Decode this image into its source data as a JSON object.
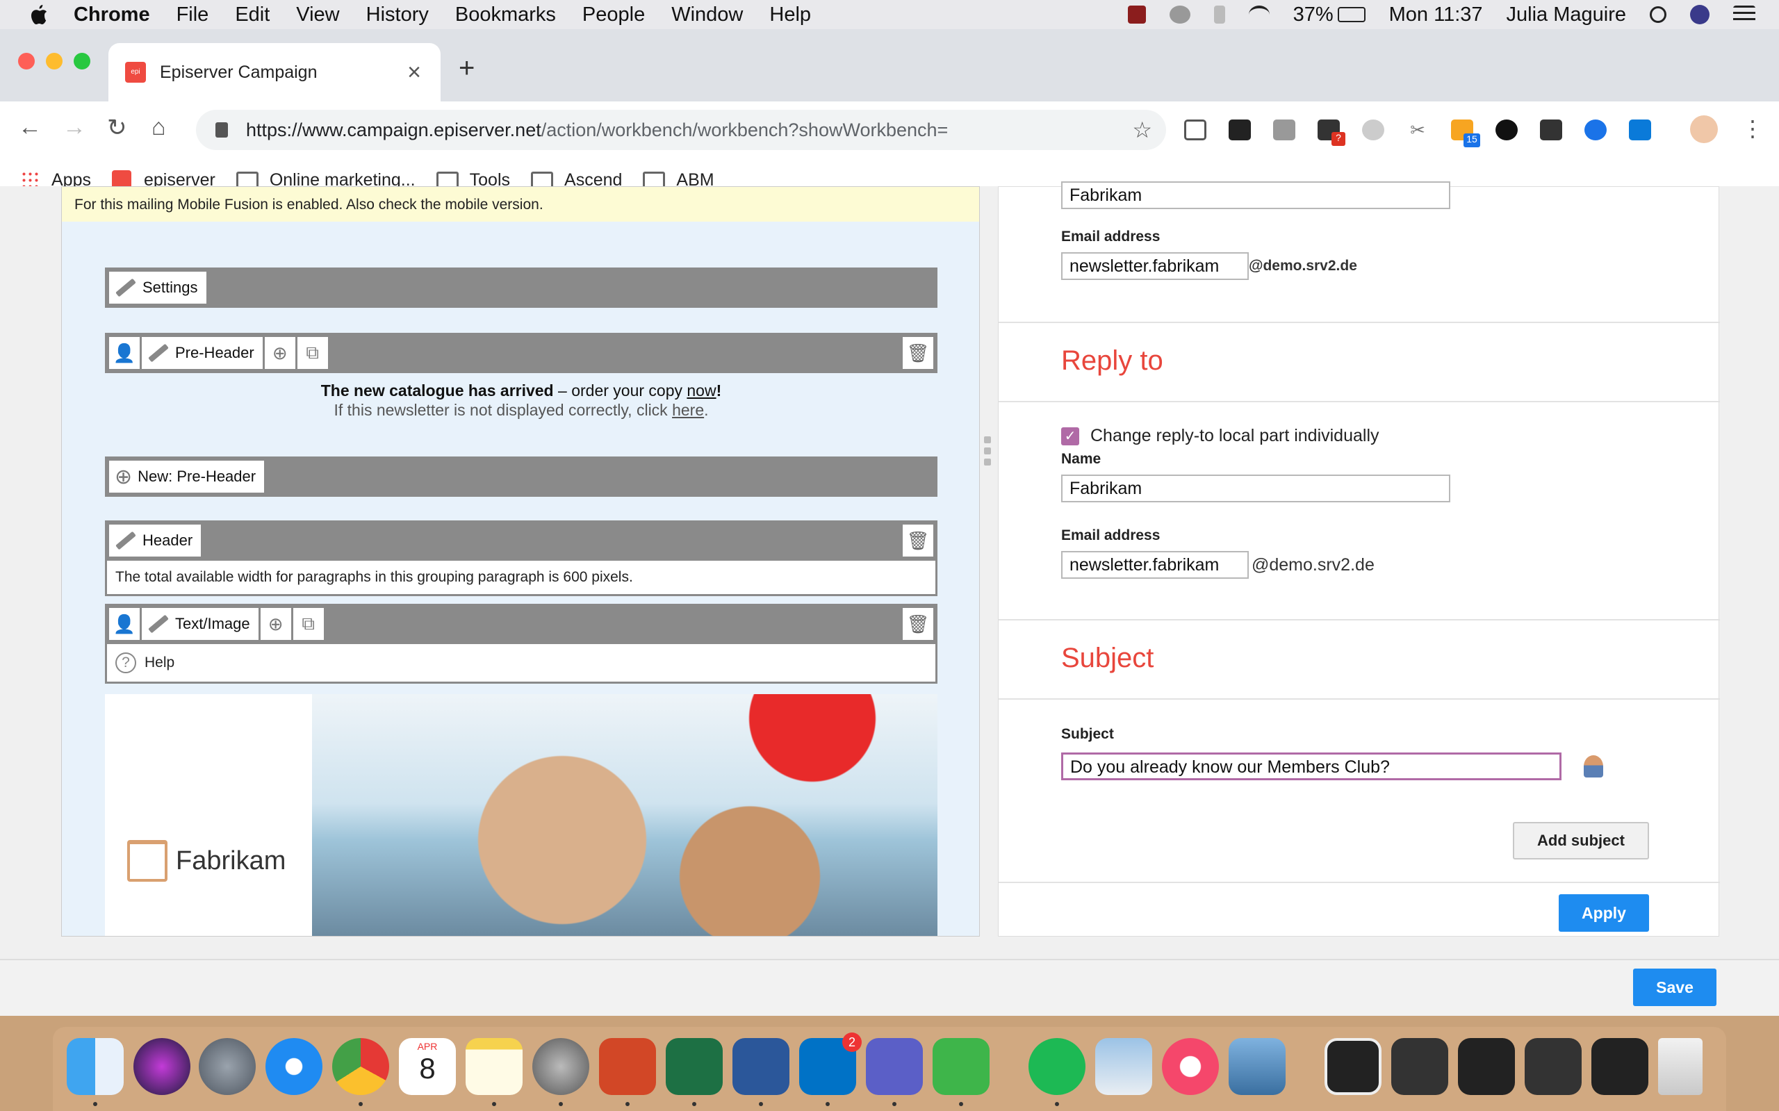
{
  "menubar": {
    "app": "Chrome",
    "items": [
      "File",
      "Edit",
      "View",
      "History",
      "Bookmarks",
      "People",
      "Window",
      "Help"
    ],
    "battery": "37%",
    "clock": "Mon 11:37",
    "user": "Julia Maguire"
  },
  "tab": {
    "title": "Episerver Campaign",
    "close": "×",
    "new": "+"
  },
  "omnibox": {
    "host": "https://www.campaign.episerver.net",
    "path": "/action/workbench/workbench?showWorkbench="
  },
  "bookmarks": [
    "Apps",
    "episerver",
    "Online marketing...",
    "Tools",
    "Ascend",
    "ABM"
  ],
  "extensions": {
    "badge_red": "?",
    "badge_rss": "15"
  },
  "left": {
    "notice": "For this mailing Mobile Fusion is enabled. Also check the mobile version.",
    "settings_label": "Settings",
    "preheader_label": "Pre-Header",
    "preheader_bold": "The new catalogue has arrived",
    "preheader_rest": " – order your copy ",
    "preheader_link": "now",
    "preheader_end": "!",
    "preheader_line2": "If this newsletter is not displayed correctly, click ",
    "preheader_link2": "here",
    "preheader_line2_end": ".",
    "new_preheader_label": "New: Pre-Header",
    "header_label": "Header",
    "header_note": "The total available width for paragraphs in this grouping paragraph is 600 pixels.",
    "textimage_label": "Text/Image",
    "help_label": "Help",
    "logo_text": "Fabrikam"
  },
  "right": {
    "top_name_value": "Fabrikam",
    "email_label_1": "Email address",
    "email_value_1": "newsletter.fabrikam",
    "email_suffix_1": "@demo.srv2.de",
    "reply_title": "Reply to",
    "reply_checkbox_label": "Change reply-to local part individually",
    "name_label": "Name",
    "name_value": "Fabrikam",
    "email_label_2": "Email address",
    "email_value_2": "newsletter.fabrikam",
    "email_suffix_2": "@demo.srv2.de",
    "subject_title": "Subject",
    "subject_label": "Subject",
    "subject_value": "Do you already know our Members Club?",
    "add_subject": "Add subject",
    "apply": "Apply"
  },
  "footer": {
    "save": "Save"
  },
  "dock": {
    "calendar_month": "APR",
    "calendar_day": "8",
    "outlook_badge": "2"
  }
}
